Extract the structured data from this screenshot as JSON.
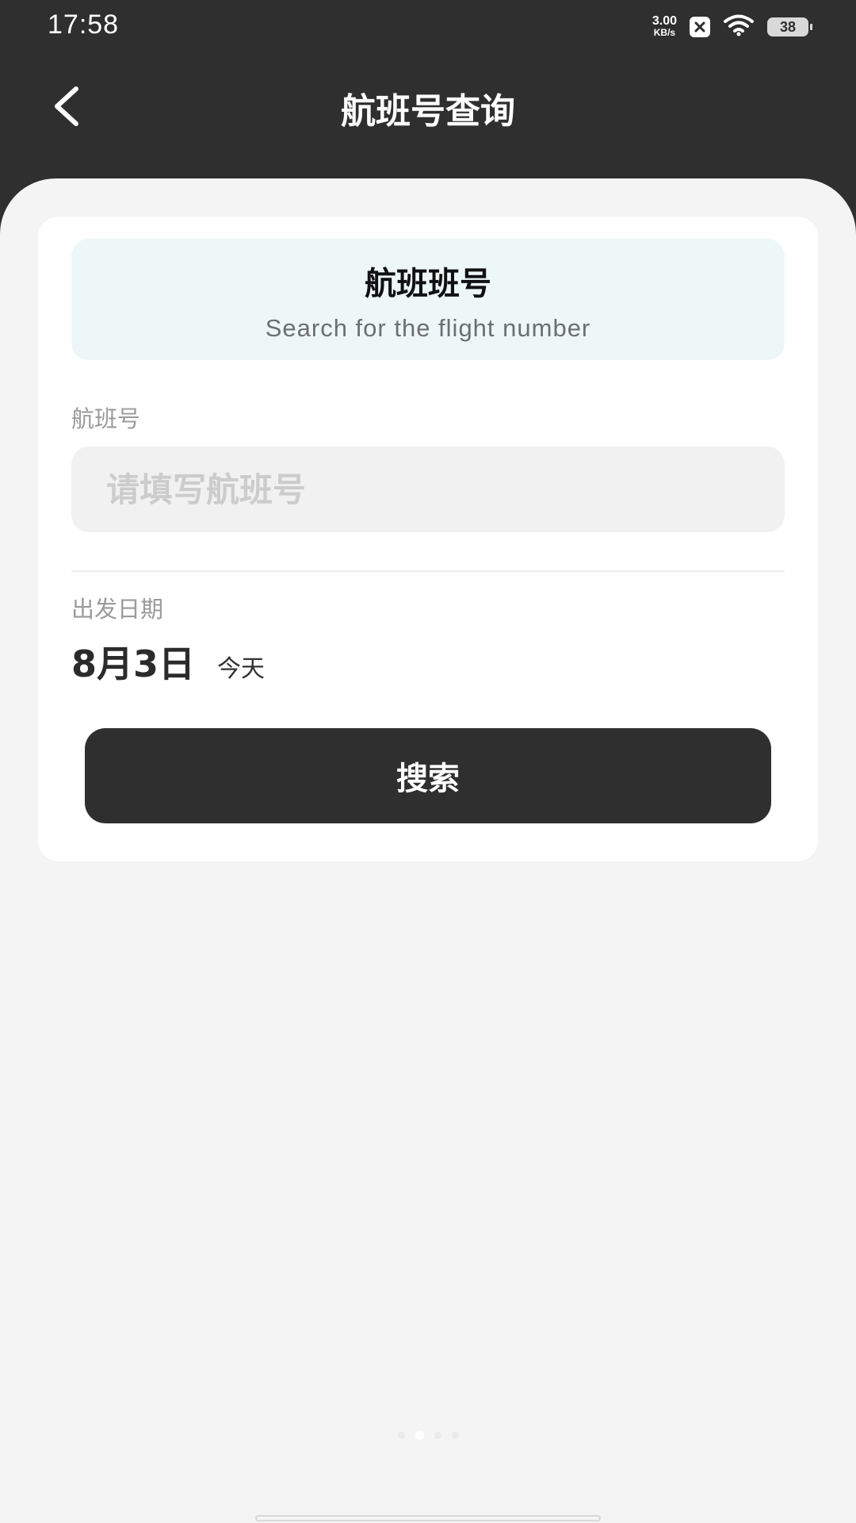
{
  "status_bar": {
    "time": "17:58",
    "net_speed_value": "3.00",
    "net_speed_unit": "KB/s",
    "battery": "38",
    "icons": [
      "close-notification-icon",
      "wifi-icon",
      "battery-icon"
    ]
  },
  "header": {
    "title": "航班号查询",
    "back_icon": "chevron-left-icon"
  },
  "banner": {
    "title": "航班班号",
    "subtitle": "Search for the flight number"
  },
  "flight_field": {
    "label": "航班号",
    "placeholder": "请填写航班号",
    "value": ""
  },
  "date_field": {
    "label": "出发日期",
    "value": "8月3日",
    "relative": "今天"
  },
  "search_button": {
    "label": "搜索"
  },
  "pager": {
    "count": 4,
    "active_index": 1
  },
  "colors": {
    "header_bg": "#2f2f2f",
    "page_bg": "#f4f4f4",
    "banner_bg": "#edf7f8",
    "button_bg": "#2f2f2f"
  }
}
